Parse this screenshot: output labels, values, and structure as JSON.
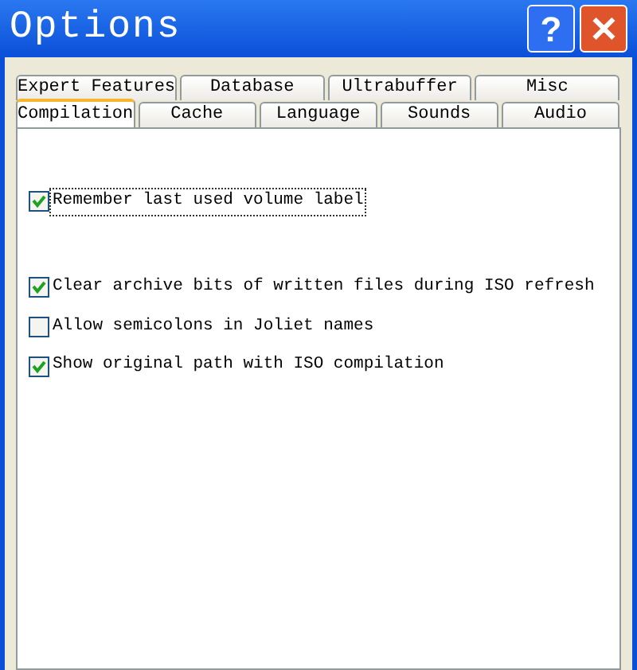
{
  "window": {
    "title": "Options",
    "buttons": [
      {
        "kind": "help",
        "label": "?"
      },
      {
        "kind": "close",
        "label": "✕"
      }
    ]
  },
  "tab_rows": [
    {
      "tabs": [
        {
          "label": "Expert Features",
          "selected": false
        },
        {
          "label": "Database",
          "selected": false
        },
        {
          "label": "Ultrabuffer",
          "selected": false
        },
        {
          "label": "Misc",
          "selected": false
        }
      ]
    },
    {
      "tabs": [
        {
          "label": "Compilation",
          "selected": true
        },
        {
          "label": "Cache",
          "selected": false
        },
        {
          "label": "Language",
          "selected": false
        },
        {
          "label": "Sounds",
          "selected": false
        },
        {
          "label": "Audio",
          "selected": false
        }
      ]
    }
  ],
  "groups": [
    [
      {
        "label": "Remember last used volume label",
        "checked": true,
        "focused": true
      }
    ],
    [
      {
        "label": "Clear archive bits of written files during ISO refresh",
        "checked": true,
        "focused": false
      },
      {
        "label": "Allow semicolons in Joliet names",
        "checked": false,
        "focused": false
      },
      {
        "label": "Show original path with ISO compilation",
        "checked": true,
        "focused": false
      }
    ]
  ]
}
